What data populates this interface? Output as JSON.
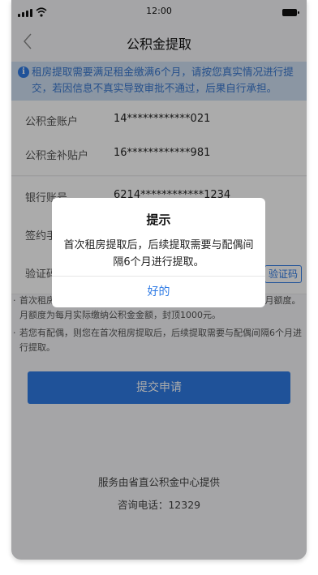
{
  "status_bar": {
    "time": "12:00"
  },
  "nav": {
    "title": "公积金提取"
  },
  "notice": {
    "text": "租房提取需要满足租金缴满6个月，请按您真实情况进行提交，若因信息不真实导致审批不通过，后果自行承担。"
  },
  "form": {
    "rows": [
      {
        "label": "公积金账户",
        "value": "14************021"
      },
      {
        "label": "公积金补贴户",
        "value": "16************981"
      },
      {
        "label": "银行账号",
        "value": "6214************1234"
      },
      {
        "label": "签约手机",
        "value": ""
      },
      {
        "label": "验证码",
        "value": ""
      }
    ],
    "code_button": "验证码"
  },
  "tips": [
    "首次租房提取，可提取金额为最近一次缴存后至今的间隔月数*月额度。月额度为每月实际缴纳公积金金额，封顶1000元。",
    "若您有配偶，则您在首次租房提取后，后续提取需要与配偶间隔6个月进行提取。"
  ],
  "submit_label": "提交申请",
  "footer": {
    "service": "服务由省直公积金中心提供",
    "phone": "咨询电话：12329"
  },
  "dialog": {
    "title": "提示",
    "message": "首次租房提取后，后续提取需要与配偶间隔6个月进行提取。",
    "ok_label": "好的"
  }
}
